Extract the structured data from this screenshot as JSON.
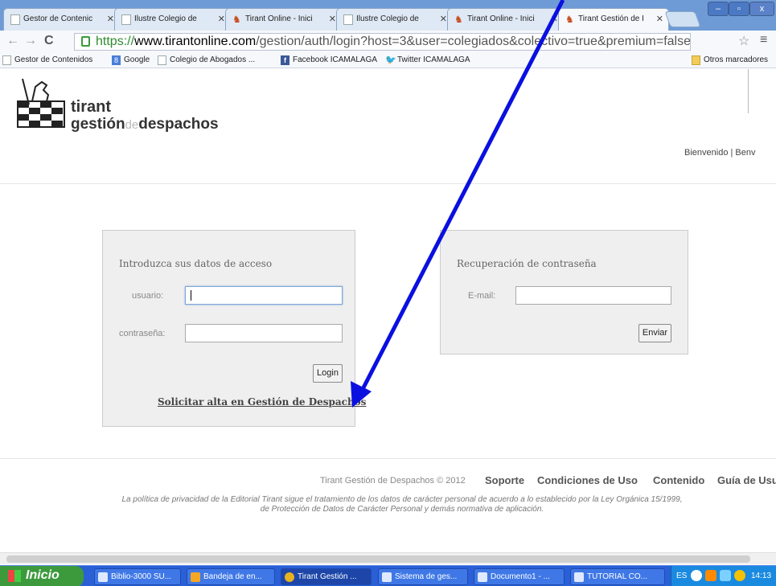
{
  "tabs": [
    {
      "label": "Gestor de Contenic",
      "icon": "page-icon"
    },
    {
      "label": "Ilustre Colegio de",
      "icon": "page-icon"
    },
    {
      "label": "Tirant Online - Inici",
      "icon": "tirant-icon"
    },
    {
      "label": "Ilustre Colegio de",
      "icon": "page-icon"
    },
    {
      "label": "Tirant Online - Inici",
      "icon": "tirant-icon"
    },
    {
      "label": "Tirant Gestión de I",
      "icon": "tirant-icon"
    }
  ],
  "window_controls": {
    "minimize": "–",
    "maximize": "▫",
    "close": "x"
  },
  "url": {
    "scheme": "https://",
    "host": "www.tirantonline.com",
    "path": "/gestion/auth/login?host=3&user=colegiados&colectivo=true&premium=false"
  },
  "bookmarks": [
    {
      "label": "Gestor de Contenidos",
      "icon": "page-icon"
    },
    {
      "label": "Google",
      "icon": "google-icon"
    },
    {
      "label": "Colegio de Abogados ...",
      "icon": "page-icon"
    },
    {
      "label": "Facebook ICAMALAGA",
      "icon": "facebook-icon"
    },
    {
      "label": "Twitter ICAMALAGA",
      "icon": "twitter-icon"
    }
  ],
  "other_bookmarks": "Otros marcadores",
  "logo": {
    "line1": "tirant",
    "line2_a": "gestión",
    "line2_b": "de",
    "line2_c": "despachos"
  },
  "welcome": "Bienvenido  |  Benv",
  "login": {
    "title": "Introduzca sus datos de acceso",
    "user_label": "usuario:",
    "user_value": "",
    "password_label": "contraseña:",
    "password_value": "",
    "button": "Login",
    "signup_link": "Solicitar alta en Gestión de Despachos"
  },
  "recovery": {
    "title": "Recuperación de contraseña",
    "email_label": "E-mail:",
    "email_value": "",
    "button": "Enviar"
  },
  "footer": {
    "copyright": "Tirant Gestión de Despachos © 2012",
    "links": [
      "Soporte",
      "Condiciones de Uso",
      "Contenido",
      "Guía de Usu"
    ],
    "privacy_line1": "La política de privacidad de la Editorial Tirant sigue el tratamiento de los datos de carácter personal de acuerdo a lo establecido por la Ley Orgánica 15/1999,",
    "privacy_line2": "de Protección de Datos de Carácter Personal y demás normativa de aplicación."
  },
  "taskbar": {
    "start": "Inicio",
    "items": [
      "Biblio-3000 SU...",
      "Bandeja de en...",
      "Tirant Gestión ...",
      "Sistema de ges...",
      "Documento1 - ...",
      "TUTORIAL CO..."
    ],
    "lang": "ES",
    "time": "14:13"
  },
  "colors": {
    "arrow": "#0a10e0",
    "tab_strip": "#6e9bd6",
    "taskbar": "#2a5fd6",
    "start": "#3c9a3c"
  }
}
